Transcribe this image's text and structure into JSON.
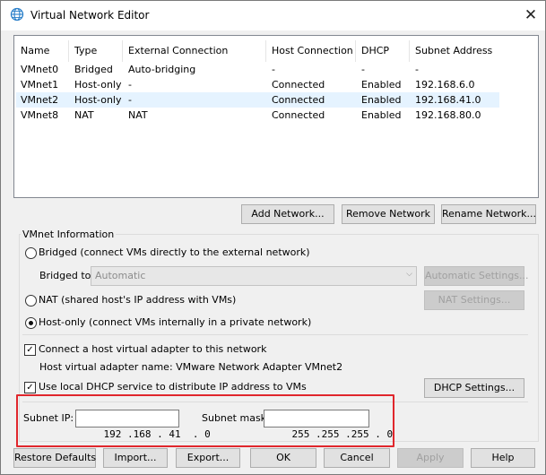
{
  "window": {
    "title": "Virtual Network Editor",
    "close_glyph": "✕",
    "icon": "globe-network-icon"
  },
  "table": {
    "columns": [
      "Name",
      "Type",
      "External Connection",
      "Host Connection",
      "DHCP",
      "Subnet Address"
    ],
    "rows": [
      {
        "name": "VMnet0",
        "type": "Bridged",
        "external": "Auto-bridging",
        "host": "-",
        "dhcp": "-",
        "subnet": "-"
      },
      {
        "name": "VMnet1",
        "type": "Host-only",
        "external": "-",
        "host": "Connected",
        "dhcp": "Enabled",
        "subnet": "192.168.6.0"
      },
      {
        "name": "VMnet2",
        "type": "Host-only",
        "external": "-",
        "host": "Connected",
        "dhcp": "Enabled",
        "subnet": "192.168.41.0"
      },
      {
        "name": "VMnet8",
        "type": "NAT",
        "external": "NAT",
        "host": "Connected",
        "dhcp": "Enabled",
        "subnet": "192.168.80.0"
      }
    ],
    "selected_row": "VMnet2"
  },
  "network_buttons": {
    "add": "Add Network...",
    "remove": "Remove Network",
    "rename": "Rename Network..."
  },
  "vmnet_info": {
    "group_label": "VMnet Information",
    "bridged_label": "Bridged (connect VMs directly to the external network)",
    "bridged_to_label": "Bridged to:",
    "bridged_to_value": "Automatic",
    "automatic_settings": "Automatic Settings...",
    "nat_label": "NAT (shared host's IP address with VMs)",
    "nat_settings": "NAT Settings...",
    "hostonly_label": "Host-only (connect VMs internally in a private network)",
    "selected_mode": "host-only",
    "connect_adapter_label": "Connect a host virtual adapter to this network",
    "connect_adapter_checked": true,
    "adapter_name_text": "Host virtual adapter name: VMware Network Adapter VMnet2",
    "dhcp_label": "Use local DHCP service to distribute IP address to VMs",
    "dhcp_checked": true,
    "dhcp_settings": "DHCP Settings...",
    "subnet_ip_label": "Subnet IP:",
    "subnet_ip_value": "192 .168 . 41  . 0",
    "subnet_mask_label": "Subnet mask:",
    "subnet_mask_value": "255 .255 .255 . 0"
  },
  "footer_buttons": {
    "restore": "Restore Defaults",
    "import": "Import...",
    "export": "Export...",
    "ok": "OK",
    "cancel": "Cancel",
    "apply": "Apply",
    "help": "Help"
  },
  "colors": {
    "highlight_box": "#e0262c",
    "selected_row": "#e5f3ff",
    "window_bg": "#f0f0f0"
  }
}
